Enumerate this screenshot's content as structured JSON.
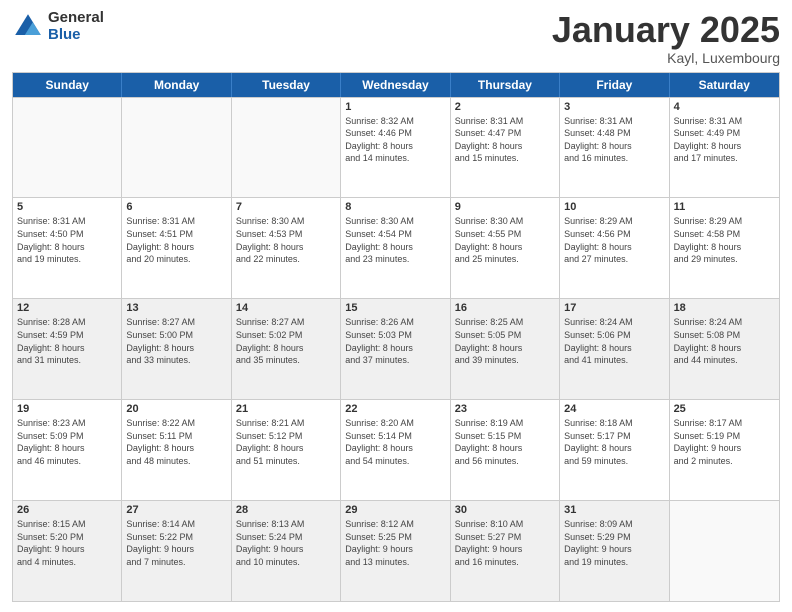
{
  "logo": {
    "general": "General",
    "blue": "Blue"
  },
  "header": {
    "title": "January 2025",
    "location": "Kayl, Luxembourg"
  },
  "weekdays": [
    "Sunday",
    "Monday",
    "Tuesday",
    "Wednesday",
    "Thursday",
    "Friday",
    "Saturday"
  ],
  "rows": [
    [
      {
        "day": "",
        "info": ""
      },
      {
        "day": "",
        "info": ""
      },
      {
        "day": "",
        "info": ""
      },
      {
        "day": "1",
        "info": "Sunrise: 8:32 AM\nSunset: 4:46 PM\nDaylight: 8 hours\nand 14 minutes."
      },
      {
        "day": "2",
        "info": "Sunrise: 8:31 AM\nSunset: 4:47 PM\nDaylight: 8 hours\nand 15 minutes."
      },
      {
        "day": "3",
        "info": "Sunrise: 8:31 AM\nSunset: 4:48 PM\nDaylight: 8 hours\nand 16 minutes."
      },
      {
        "day": "4",
        "info": "Sunrise: 8:31 AM\nSunset: 4:49 PM\nDaylight: 8 hours\nand 17 minutes."
      }
    ],
    [
      {
        "day": "5",
        "info": "Sunrise: 8:31 AM\nSunset: 4:50 PM\nDaylight: 8 hours\nand 19 minutes."
      },
      {
        "day": "6",
        "info": "Sunrise: 8:31 AM\nSunset: 4:51 PM\nDaylight: 8 hours\nand 20 minutes."
      },
      {
        "day": "7",
        "info": "Sunrise: 8:30 AM\nSunset: 4:53 PM\nDaylight: 8 hours\nand 22 minutes."
      },
      {
        "day": "8",
        "info": "Sunrise: 8:30 AM\nSunset: 4:54 PM\nDaylight: 8 hours\nand 23 minutes."
      },
      {
        "day": "9",
        "info": "Sunrise: 8:30 AM\nSunset: 4:55 PM\nDaylight: 8 hours\nand 25 minutes."
      },
      {
        "day": "10",
        "info": "Sunrise: 8:29 AM\nSunset: 4:56 PM\nDaylight: 8 hours\nand 27 minutes."
      },
      {
        "day": "11",
        "info": "Sunrise: 8:29 AM\nSunset: 4:58 PM\nDaylight: 8 hours\nand 29 minutes."
      }
    ],
    [
      {
        "day": "12",
        "info": "Sunrise: 8:28 AM\nSunset: 4:59 PM\nDaylight: 8 hours\nand 31 minutes."
      },
      {
        "day": "13",
        "info": "Sunrise: 8:27 AM\nSunset: 5:00 PM\nDaylight: 8 hours\nand 33 minutes."
      },
      {
        "day": "14",
        "info": "Sunrise: 8:27 AM\nSunset: 5:02 PM\nDaylight: 8 hours\nand 35 minutes."
      },
      {
        "day": "15",
        "info": "Sunrise: 8:26 AM\nSunset: 5:03 PM\nDaylight: 8 hours\nand 37 minutes."
      },
      {
        "day": "16",
        "info": "Sunrise: 8:25 AM\nSunset: 5:05 PM\nDaylight: 8 hours\nand 39 minutes."
      },
      {
        "day": "17",
        "info": "Sunrise: 8:24 AM\nSunset: 5:06 PM\nDaylight: 8 hours\nand 41 minutes."
      },
      {
        "day": "18",
        "info": "Sunrise: 8:24 AM\nSunset: 5:08 PM\nDaylight: 8 hours\nand 44 minutes."
      }
    ],
    [
      {
        "day": "19",
        "info": "Sunrise: 8:23 AM\nSunset: 5:09 PM\nDaylight: 8 hours\nand 46 minutes."
      },
      {
        "day": "20",
        "info": "Sunrise: 8:22 AM\nSunset: 5:11 PM\nDaylight: 8 hours\nand 48 minutes."
      },
      {
        "day": "21",
        "info": "Sunrise: 8:21 AM\nSunset: 5:12 PM\nDaylight: 8 hours\nand 51 minutes."
      },
      {
        "day": "22",
        "info": "Sunrise: 8:20 AM\nSunset: 5:14 PM\nDaylight: 8 hours\nand 54 minutes."
      },
      {
        "day": "23",
        "info": "Sunrise: 8:19 AM\nSunset: 5:15 PM\nDaylight: 8 hours\nand 56 minutes."
      },
      {
        "day": "24",
        "info": "Sunrise: 8:18 AM\nSunset: 5:17 PM\nDaylight: 8 hours\nand 59 minutes."
      },
      {
        "day": "25",
        "info": "Sunrise: 8:17 AM\nSunset: 5:19 PM\nDaylight: 9 hours\nand 2 minutes."
      }
    ],
    [
      {
        "day": "26",
        "info": "Sunrise: 8:15 AM\nSunset: 5:20 PM\nDaylight: 9 hours\nand 4 minutes."
      },
      {
        "day": "27",
        "info": "Sunrise: 8:14 AM\nSunset: 5:22 PM\nDaylight: 9 hours\nand 7 minutes."
      },
      {
        "day": "28",
        "info": "Sunrise: 8:13 AM\nSunset: 5:24 PM\nDaylight: 9 hours\nand 10 minutes."
      },
      {
        "day": "29",
        "info": "Sunrise: 8:12 AM\nSunset: 5:25 PM\nDaylight: 9 hours\nand 13 minutes."
      },
      {
        "day": "30",
        "info": "Sunrise: 8:10 AM\nSunset: 5:27 PM\nDaylight: 9 hours\nand 16 minutes."
      },
      {
        "day": "31",
        "info": "Sunrise: 8:09 AM\nSunset: 5:29 PM\nDaylight: 9 hours\nand 19 minutes."
      },
      {
        "day": "",
        "info": ""
      }
    ]
  ]
}
